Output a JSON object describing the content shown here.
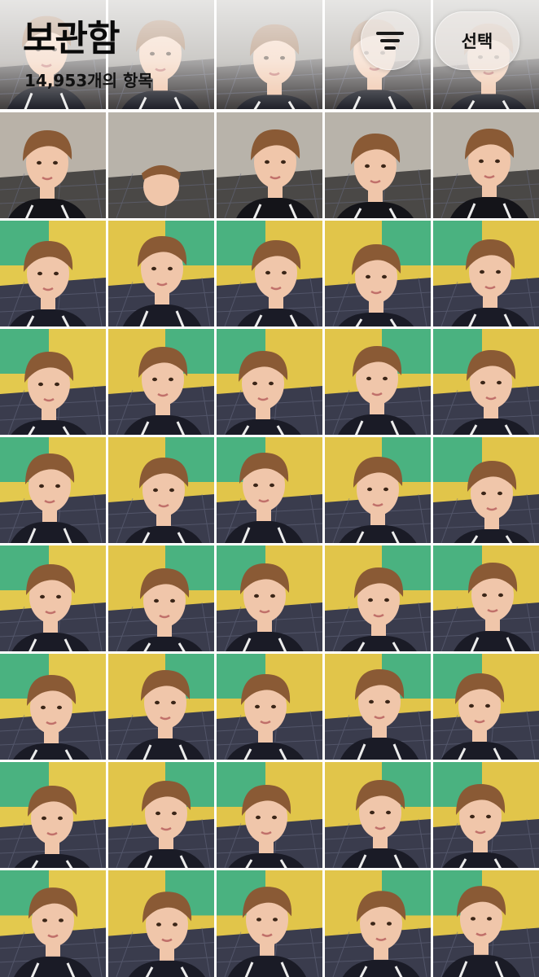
{
  "header": {
    "title": "보관함",
    "count_text": "14,953개의 항목",
    "select_label": "선택",
    "filter_icon": "line-horizontal-3-decrease-icon"
  },
  "grid": {
    "columns": 5,
    "rows": 9,
    "items": [
      {
        "bg": "#8f8a84",
        "floor": "#3d3a3a",
        "shirt": "#1b1c25",
        "wide": false
      },
      {
        "bg": "#8e8a83",
        "floor": "#3d3a3a",
        "shirt": "#1b1c25",
        "wide": false
      },
      {
        "bg": "#8e8a83",
        "floor": "#3d3a3a",
        "shirt": "#1b1c25",
        "wide": false
      },
      {
        "bg": "#8e8a83",
        "floor": "#3d3a3a",
        "shirt": "#1b1c25",
        "wide": false
      },
      {
        "bg": "#8e8a83",
        "floor": "#3d3a3a",
        "shirt": "#1b1c25",
        "wide": false
      },
      {
        "bg": "#b9b2a8",
        "floor": "#4a4846",
        "shirt": "#141419",
        "wide": false
      },
      {
        "bg": "#b8b3aa",
        "floor": "#4a4846",
        "shirt": "#141419",
        "wide": true
      },
      {
        "bg": "#b8b3aa",
        "floor": "#4a4846",
        "shirt": "#141419",
        "wide": false
      },
      {
        "bg": "#b8b3aa",
        "floor": "#4a4846",
        "shirt": "#141419",
        "wide": false
      },
      {
        "bg": "#b8b3aa",
        "floor": "#4a4846",
        "shirt": "#141419",
        "wide": false
      },
      {
        "bg": "#e3c94e",
        "floor": "#3a3c4d",
        "shirt": "#1a1b26",
        "wide": false
      },
      {
        "bg": "#e1c54a",
        "floor": "#3a3c4d",
        "shirt": "#1a1b26",
        "wide": false
      },
      {
        "bg": "#e1c54a",
        "floor": "#3a3c4d",
        "shirt": "#1a1b26",
        "wide": false
      },
      {
        "bg": "#e1c54a",
        "floor": "#3a3c4d",
        "shirt": "#1a1b26",
        "wide": false
      },
      {
        "bg": "#e1c54a",
        "floor": "#3a3c4d",
        "shirt": "#1a1b26",
        "wide": false
      },
      {
        "bg": "#e3c94e",
        "floor": "#3a3c4d",
        "shirt": "#1a1b26",
        "wide": false
      },
      {
        "bg": "#e1c54a",
        "floor": "#3a3c4d",
        "shirt": "#1a1b26",
        "wide": false
      },
      {
        "bg": "#e1c54a",
        "floor": "#3a3c4d",
        "shirt": "#1a1b26",
        "wide": false
      },
      {
        "bg": "#e1c54a",
        "floor": "#3a3c4d",
        "shirt": "#1a1b26",
        "wide": false
      },
      {
        "bg": "#e1c54a",
        "floor": "#3a3c4d",
        "shirt": "#1a1b26",
        "wide": false
      },
      {
        "bg": "#e3c94e",
        "floor": "#3a3c4d",
        "shirt": "#1a1b26",
        "wide": false
      },
      {
        "bg": "#e1c54a",
        "floor": "#3a3c4d",
        "shirt": "#1a1b26",
        "wide": false
      },
      {
        "bg": "#e1c54a",
        "floor": "#3a3c4d",
        "shirt": "#1a1b26",
        "wide": false
      },
      {
        "bg": "#e1c54a",
        "floor": "#3a3c4d",
        "shirt": "#1a1b26",
        "wide": false
      },
      {
        "bg": "#e1c54a",
        "floor": "#3a3c4d",
        "shirt": "#1a1b26",
        "wide": false
      },
      {
        "bg": "#e3c94e",
        "floor": "#3a3c4d",
        "shirt": "#1a1b26",
        "wide": false
      },
      {
        "bg": "#e1c54a",
        "floor": "#3a3c4d",
        "shirt": "#1a1b26",
        "wide": false
      },
      {
        "bg": "#e1c54a",
        "floor": "#3a3c4d",
        "shirt": "#1a1b26",
        "wide": false
      },
      {
        "bg": "#e1c54a",
        "floor": "#3a3c4d",
        "shirt": "#1a1b26",
        "wide": false
      },
      {
        "bg": "#e1c54a",
        "floor": "#3a3c4d",
        "shirt": "#1a1b26",
        "wide": false
      },
      {
        "bg": "#e3c94e",
        "floor": "#3a3c4d",
        "shirt": "#1a1b26",
        "wide": false
      },
      {
        "bg": "#e1c54a",
        "floor": "#3a3c4d",
        "shirt": "#1a1b26",
        "wide": false
      },
      {
        "bg": "#e1c54a",
        "floor": "#3a3c4d",
        "shirt": "#1a1b26",
        "wide": false
      },
      {
        "bg": "#e1c54a",
        "floor": "#3a3c4d",
        "shirt": "#1a1b26",
        "wide": false
      },
      {
        "bg": "#e1c54a",
        "floor": "#3a3c4d",
        "shirt": "#1a1b26",
        "wide": false
      },
      {
        "bg": "#e3c94e",
        "floor": "#3a3c4d",
        "shirt": "#1a1b26",
        "wide": false
      },
      {
        "bg": "#e1c54a",
        "floor": "#3a3c4d",
        "shirt": "#1a1b26",
        "wide": false
      },
      {
        "bg": "#e1c54a",
        "floor": "#3a3c4d",
        "shirt": "#1a1b26",
        "wide": false
      },
      {
        "bg": "#e1c54a",
        "floor": "#3a3c4d",
        "shirt": "#1a1b26",
        "wide": false
      },
      {
        "bg": "#e1c54a",
        "floor": "#3a3c4d",
        "shirt": "#1a1b26",
        "wide": false
      },
      {
        "bg": "#e3c94e",
        "floor": "#3a3c4d",
        "shirt": "#1a1b26",
        "wide": false
      },
      {
        "bg": "#e1c54a",
        "floor": "#3a3c4d",
        "shirt": "#1a1b26",
        "wide": false
      },
      {
        "bg": "#e1c54a",
        "floor": "#3a3c4d",
        "shirt": "#1a1b26",
        "wide": false
      },
      {
        "bg": "#e1c54a",
        "floor": "#3a3c4d",
        "shirt": "#1a1b26",
        "wide": false
      },
      {
        "bg": "#e1c54a",
        "floor": "#3a3c4d",
        "shirt": "#1a1b26",
        "wide": false
      }
    ]
  },
  "colors": {
    "banner_green": "#2fae8a",
    "skin": "#f0c6aa",
    "hair": "#8a5a35"
  }
}
